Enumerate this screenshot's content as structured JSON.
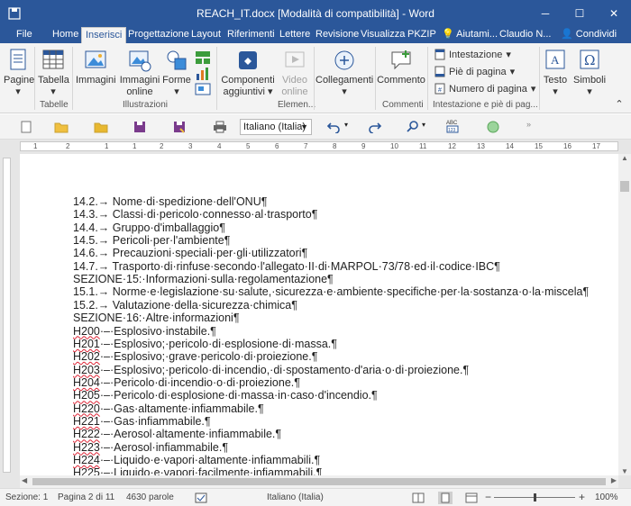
{
  "window": {
    "title": "REACH_IT.docx [Modalità di compatibilità] - Word",
    "minimize": "─",
    "maximize": "☐",
    "close": "✕"
  },
  "tabs": [
    {
      "label": "File"
    },
    {
      "label": "Home"
    },
    {
      "label": "Inserisci",
      "active": true
    },
    {
      "label": "Progettazione"
    },
    {
      "label": "Layout"
    },
    {
      "label": "Riferimenti"
    },
    {
      "label": "Lettere"
    },
    {
      "label": "Revisione"
    },
    {
      "label": "Visualizza"
    },
    {
      "label": "PKZIP"
    },
    {
      "label": "Aiutami..."
    },
    {
      "label": "Claudio N..."
    },
    {
      "label": "Condividi"
    }
  ],
  "ribbon": {
    "pagine": "Pagine",
    "tabella": "Tabella",
    "immagini": "Immagini",
    "immagini_online_1": "Immagini",
    "immagini_online_2": "online",
    "forme": "Forme",
    "componenti_1": "Componenti",
    "componenti_2": "aggiuntivi",
    "video_1": "Video",
    "video_2": "online",
    "collegamenti": "Collegamenti",
    "commento": "Commento",
    "intestazione": "Intestazione",
    "pie_pagina": "Piè di pagina",
    "numero_pagina": "Numero di pagina",
    "testo": "Testo",
    "simboli": "Simboli",
    "groups": {
      "tabelle": "Tabelle",
      "illustrazioni": "Illustrazioni",
      "elementi": "Elemen...",
      "commenti": "Commenti",
      "intestazione_pie": "Intestazione e piè di pag..."
    }
  },
  "qat": {
    "language": "Italiano (Italia)"
  },
  "ruler": {
    "numbers": [
      "1",
      "2",
      "1",
      "1",
      "2",
      "3",
      "4",
      "5",
      "6",
      "7",
      "8",
      "9",
      "10",
      "11",
      "12",
      "13",
      "14",
      "15",
      "16",
      "17",
      "18",
      "19"
    ]
  },
  "document": {
    "lines": [
      {
        "text": "14.2.→ Nome·di·spedizione·dell'ONU¶"
      },
      {
        "text": "14.3.→ Classi·di·pericolo·connesso·al·trasporto¶"
      },
      {
        "text": "14.4.→ Gruppo·d'imballaggio¶"
      },
      {
        "text": "14.5.→ Pericoli·per·l'ambiente¶"
      },
      {
        "text": "14.6.→ Precauzioni·speciali·per·gli·utilizzatori¶"
      },
      {
        "text": "14.7.→ Trasporto·di·rinfuse·secondo·l'allegato·II·di·MARPOL·73/78·ed·il·codice·IBC¶"
      },
      {
        "text": "SEZIONE·15:·Informazioni·sulla·regolamentazione¶"
      },
      {
        "text": "15.1.→ Norme·e·legislazione·su·salute,·sicurezza·e·ambiente·specifiche·per·la·sostanza·o·la·miscela¶"
      },
      {
        "text": "15.2.→ Valutazione·della·sicurezza·chimica¶"
      },
      {
        "text": "SEZIONE·16:·Altre·informazioni¶"
      },
      {
        "code": "H200",
        "text": "·–·Esplosivo·instabile.¶"
      },
      {
        "code": "H201",
        "text": "·–·Esplosivo;·pericolo·di·esplosione·di·massa.¶"
      },
      {
        "code": "H202",
        "text": "·–·Esplosivo;·grave·pericolo·di·proiezione.¶"
      },
      {
        "code": "H203",
        "text": "·–·Esplosivo;·pericolo·di·incendio,·di·spostamento·d'aria·o·di·proiezione.¶"
      },
      {
        "code": "H204",
        "text": "·–·Pericolo·di·incendio·o·di·proiezione.¶"
      },
      {
        "code": "H205",
        "text": "·–·Pericolo·di·esplosione·di·massa·in·caso·d'incendio.¶"
      },
      {
        "code": "H220",
        "text": "·–·Gas·altamente·infiammabile.¶"
      },
      {
        "code": "H221",
        "text": "·–·Gas·infiammabile.¶"
      },
      {
        "code": "H222",
        "text": "·–·Aerosol·altamente·infiammabile.¶"
      },
      {
        "code": "H223",
        "text": "·–·Aerosol·infiammabile.¶"
      },
      {
        "code": "H224",
        "text": "·–·Liquido·e·vapori·altamente·infiammabili.¶"
      },
      {
        "code": "H225",
        "text": "·–·Liquido·e·vapori·facilmente·infiammabili.¶"
      }
    ]
  },
  "status": {
    "section": "Sezione: 1",
    "page": "Pagina 2 di 11",
    "words": "4630 parole",
    "language": "Italiano (Italia)",
    "zoom_minus": "−",
    "zoom_plus": "+",
    "zoom": "100%"
  },
  "colors": {
    "accent": "#2b579a",
    "spell_underline": "#dd2233"
  }
}
